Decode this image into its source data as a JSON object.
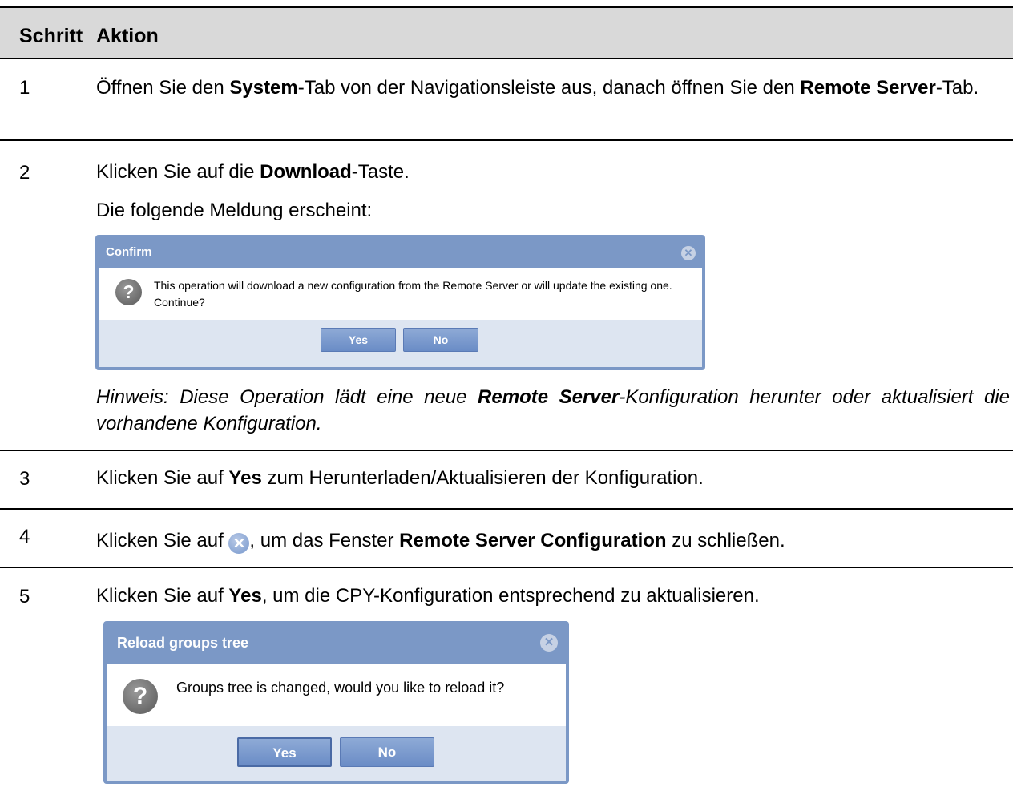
{
  "header": {
    "col_step": "Schritt",
    "col_action": "Aktion"
  },
  "rows": [
    {
      "num": "1",
      "p1_a": "Öffnen Sie den ",
      "p1_b": "System",
      "p1_c": "-Tab von der Navigationsleiste aus, danach öffnen Sie den ",
      "p1_d": "Remote Server",
      "p1_e": "-Tab."
    },
    {
      "num": "2",
      "p1_a": "Klicken Sie auf die ",
      "p1_b": "Download",
      "p1_c": "-Taste.",
      "p2": "Die folgende Meldung erscheint:",
      "note_a": "Hinweis: Diese Operation lädt eine neue ",
      "note_b": "Remote Server",
      "note_c": "-Konfiguration herunter oder aktualisiert die vorhandene Konfiguration."
    },
    {
      "num": "3",
      "p1_a": "Klicken Sie auf ",
      "p1_b": "Yes",
      "p1_c": " zum Herunterladen/Aktualisieren der Konfiguration."
    },
    {
      "num": "4",
      "p1_a": "Klicken Sie auf ",
      "p1_c": ", um das Fenster ",
      "p1_d": "Remote Server Configuration",
      "p1_e": " zu schließen."
    },
    {
      "num": "5",
      "p1_a": "Klicken Sie auf ",
      "p1_b": "Yes",
      "p1_c": ", um die CPY-Konfiguration entsprechend zu aktualisieren."
    }
  ],
  "dialog_confirm": {
    "title": "Confirm",
    "message": "This operation will download a new configuration from the Remote Server or will update the existing one. Continue?",
    "yes": "Yes",
    "no": "No",
    "icon": "question-icon",
    "close_icon": "close-icon"
  },
  "dialog_reload": {
    "title": "Reload groups tree",
    "message": "Groups tree is changed, would you like to reload it?",
    "yes": "Yes",
    "no": "No",
    "icon": "question-icon",
    "close_icon": "close-icon"
  },
  "colors": {
    "header_bg": "#d9d9d9",
    "dialog_frame": "#7b98c6",
    "button": "#6a8cc6"
  }
}
